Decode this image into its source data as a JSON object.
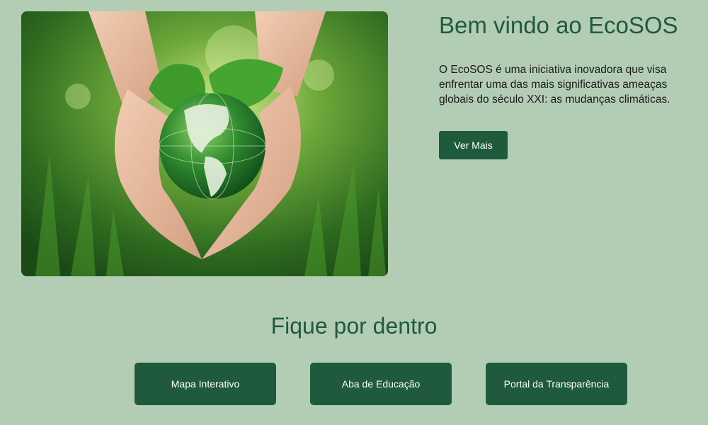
{
  "hero": {
    "image_icon": "hands-holding-globe-image"
  },
  "intro": {
    "title": "Bem vindo ao EcoSOS",
    "line1": "O EcoSOS é uma iniciativa inovadora que visa",
    "line2": "enfrentar uma das mais significativas ameaças",
    "line3": "globais do século XXI: as mudanças climáticas.",
    "more_label": "Ver Mais"
  },
  "section": {
    "title": "Fique por dentro",
    "links": [
      {
        "label": "Mapa Interativo"
      },
      {
        "label": "Aba de Educação"
      },
      {
        "label": "Portal da Transparência"
      }
    ]
  },
  "colors": {
    "background": "#b3cdb4",
    "accent": "#1f5a3c",
    "button_text": "#ffffff"
  }
}
